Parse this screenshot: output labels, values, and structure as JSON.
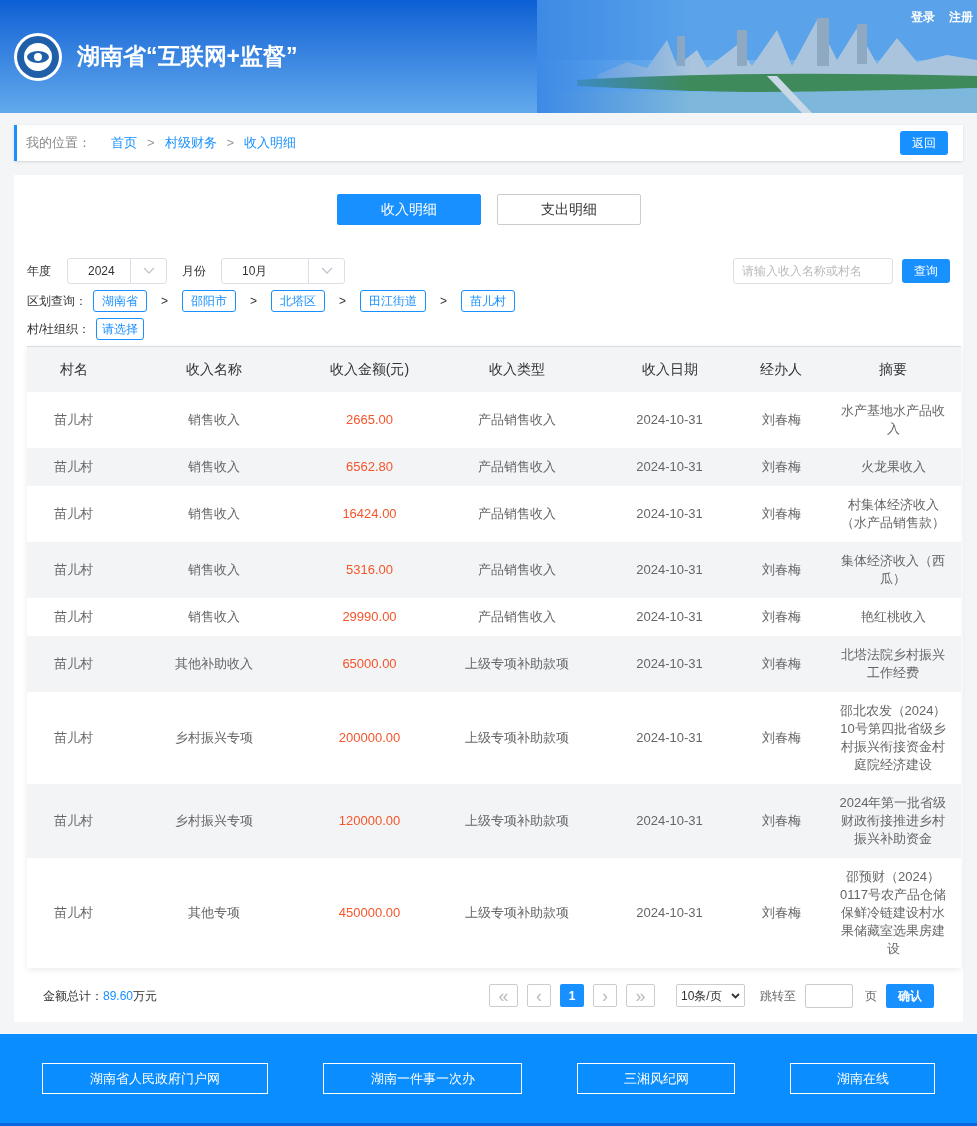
{
  "header": {
    "title": "湖南省“互联网+监督”",
    "links": [
      "登录",
      "注册"
    ]
  },
  "breadcrumb": {
    "label": "我的位置：",
    "items": [
      "首页",
      "村级财务",
      "收入明细"
    ],
    "separator": ">",
    "back": "返回"
  },
  "tabs": [
    {
      "label": "收入明细",
      "selected": true
    },
    {
      "label": "支出明细",
      "selected": false
    }
  ],
  "filters": {
    "year_label": "年度",
    "year": "2024",
    "month_label": "月份",
    "month": "10月",
    "search_placeholder": "请输入收入名称或村名",
    "search_button": "查询",
    "region_label": "区划查询：",
    "regions": [
      "湖南省",
      "邵阳市",
      "北塔区",
      "田江街道",
      "苗儿村"
    ],
    "region_separator": ">",
    "org_label": "村/社组织：",
    "org_button": "请选择"
  },
  "table": {
    "columns": [
      "村名",
      "收入名称",
      "收入金额(元)",
      "收入类型",
      "收入日期",
      "经办人",
      "摘要"
    ],
    "rows": [
      [
        "苗儿村",
        "销售收入",
        "2665.00",
        "产品销售收入",
        "2024-10-31",
        "刘春梅",
        "水产基地水产品收入"
      ],
      [
        "苗儿村",
        "销售收入",
        "6562.80",
        "产品销售收入",
        "2024-10-31",
        "刘春梅",
        "火龙果收入"
      ],
      [
        "苗儿村",
        "销售收入",
        "16424.00",
        "产品销售收入",
        "2024-10-31",
        "刘春梅",
        "村集体经济收入（水产品销售款）"
      ],
      [
        "苗儿村",
        "销售收入",
        "5316.00",
        "产品销售收入",
        "2024-10-31",
        "刘春梅",
        "集体经济收入（西瓜）"
      ],
      [
        "苗儿村",
        "销售收入",
        "29990.00",
        "产品销售收入",
        "2024-10-31",
        "刘春梅",
        "艳红桃收入"
      ],
      [
        "苗儿村",
        "其他补助收入",
        "65000.00",
        "上级专项补助款项",
        "2024-10-31",
        "刘春梅",
        "北塔法院乡村振兴工作经费"
      ],
      [
        "苗儿村",
        "乡村振兴专项",
        "200000.00",
        "上级专项补助款项",
        "2024-10-31",
        "刘春梅",
        "邵北农发（2024）10号第四批省级乡村振兴衔接资金村庭院经济建设"
      ],
      [
        "苗儿村",
        "乡村振兴专项",
        "120000.00",
        "上级专项补助款项",
        "2024-10-31",
        "刘春梅",
        "2024年第一批省级财政衔接推进乡村振兴补助资金"
      ],
      [
        "苗儿村",
        "其他专项",
        "450000.00",
        "上级专项补助款项",
        "2024-10-31",
        "刘春梅",
        "邵预财（2024）0117号农产品仓储保鲜冷链建设村水果储藏室选果房建设"
      ]
    ]
  },
  "summary": {
    "label": "金额总计：",
    "value": "89.60",
    "unit": "万元"
  },
  "pagination": {
    "first": "«",
    "prev": "‹",
    "pages": [
      {
        "label": "1",
        "selected": true
      }
    ],
    "next": "›",
    "last": "»",
    "page_size": "10条/页",
    "jump_label": "跳转至",
    "page_unit": "页",
    "confirm": "确认"
  },
  "footer_links": [
    "湖南省人民政府门户网",
    "湖南一件事一次办",
    "三湘风纪网",
    "湖南在线"
  ]
}
